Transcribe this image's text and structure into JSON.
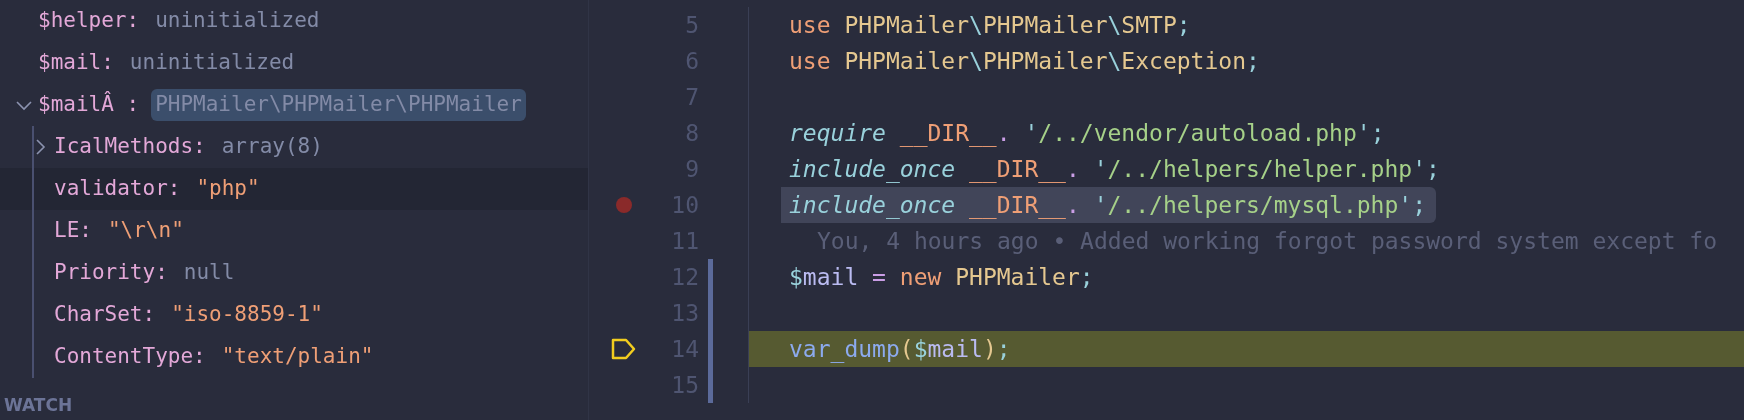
{
  "variables": [
    {
      "name": "$helper:",
      "value": "uninitialized",
      "kind": "plain"
    },
    {
      "name": "$mail:",
      "value": "uninitialized",
      "kind": "plain"
    },
    {
      "name": "$mailÂ :",
      "value": "PHPMailer\\PHPMailer\\PHPMailer",
      "kind": "plain",
      "expanded": true,
      "selected": true,
      "children": [
        {
          "name": "IcalMethods:",
          "value": "array(8)",
          "kind": "plain",
          "expanded": false
        },
        {
          "name": "validator:",
          "value": "\"php\"",
          "kind": "string",
          "focused": true
        },
        {
          "name": "LE:",
          "value": "\"\\r\\n\"",
          "kind": "string"
        },
        {
          "name": "Priority:",
          "value": "null",
          "kind": "plain"
        },
        {
          "name": "CharSet:",
          "value": "\"iso-8859-1\"",
          "kind": "string"
        },
        {
          "name": "ContentType:",
          "value": "\"text/plain\"",
          "kind": "string"
        }
      ]
    }
  ],
  "watch_header": "WATCH",
  "code_lines": [
    {
      "number": "5",
      "tokens": [
        {
          "text": "use",
          "kind": "keyword"
        },
        {
          "text": "PHPMailer",
          "kind": "class",
          "gap": true
        },
        {
          "text": "\\",
          "kind": "punct"
        },
        {
          "text": "PHPMailer",
          "kind": "class"
        },
        {
          "text": "\\",
          "kind": "punct"
        },
        {
          "text": "SMTP",
          "kind": "class"
        },
        {
          "text": ";",
          "kind": "punct"
        }
      ]
    },
    {
      "number": "6",
      "tokens": [
        {
          "text": "use",
          "kind": "keyword"
        },
        {
          "text": "PHPMailer",
          "kind": "class",
          "gap": true
        },
        {
          "text": "\\",
          "kind": "punct"
        },
        {
          "text": "PHPMailer",
          "kind": "class"
        },
        {
          "text": "\\",
          "kind": "punct"
        },
        {
          "text": "Exception",
          "kind": "class"
        },
        {
          "text": ";",
          "kind": "punct"
        }
      ]
    },
    {
      "number": "7"
    },
    {
      "number": "8",
      "tokens": [
        {
          "text": "require",
          "kind": "include"
        },
        {
          "text": "__DIR__",
          "kind": "constant",
          "gap": true
        },
        {
          "text": ".",
          "kind": "operator"
        },
        {
          "text": "'",
          "kind": "punct",
          "gap": true
        },
        {
          "text": "/../vendor/autoload.php",
          "kind": "string"
        },
        {
          "text": "'",
          "kind": "punct"
        },
        {
          "text": ";",
          "kind": "punct"
        }
      ]
    },
    {
      "number": "9",
      "tokens": [
        {
          "text": "include_once",
          "kind": "include"
        },
        {
          "text": "__DIR__",
          "kind": "constant",
          "gap": true
        },
        {
          "text": ".",
          "kind": "operator"
        },
        {
          "text": "'",
          "kind": "punct",
          "gap": true
        },
        {
          "text": "/../helpers/helper.php",
          "kind": "string"
        },
        {
          "text": "'",
          "kind": "punct"
        },
        {
          "text": ";",
          "kind": "punct"
        }
      ]
    },
    {
      "number": "10",
      "breakpoint": true,
      "selected": true,
      "tokens": [
        {
          "text": "include_once",
          "kind": "include"
        },
        {
          "text": "__DIR__",
          "kind": "constant",
          "gap": true
        },
        {
          "text": ".",
          "kind": "operator"
        },
        {
          "text": "'",
          "kind": "punct",
          "gap": true
        },
        {
          "text": "/../helpers/mysql.php",
          "kind": "string"
        },
        {
          "text": "'",
          "kind": "punct"
        },
        {
          "text": ";",
          "kind": "punct"
        }
      ]
    },
    {
      "number": "11",
      "blame": "You, 4 hours ago • Added working forgot password system except fo"
    },
    {
      "number": "12",
      "modified": true,
      "tokens": [
        {
          "text": "$",
          "kind": "variable-sign"
        },
        {
          "text": "mail",
          "kind": "variable"
        },
        {
          "text": "=",
          "kind": "operator",
          "gap": true
        },
        {
          "text": "new",
          "kind": "keyword",
          "gap": true
        },
        {
          "text": "PHPMailer",
          "kind": "class",
          "gap": true
        },
        {
          "text": ";",
          "kind": "punct"
        }
      ]
    },
    {
      "number": "13",
      "modified": true
    },
    {
      "number": "14",
      "modified": true,
      "current": true,
      "tokens": [
        {
          "text": "var_dump",
          "kind": "function"
        },
        {
          "text": "(",
          "kind": "paren"
        },
        {
          "text": "$",
          "kind": "variable-sign"
        },
        {
          "text": "mail",
          "kind": "variable"
        },
        {
          "text": ")",
          "kind": "paren"
        },
        {
          "text": ";",
          "kind": "punct"
        }
      ]
    },
    {
      "number": "15",
      "modified": true
    }
  ]
}
